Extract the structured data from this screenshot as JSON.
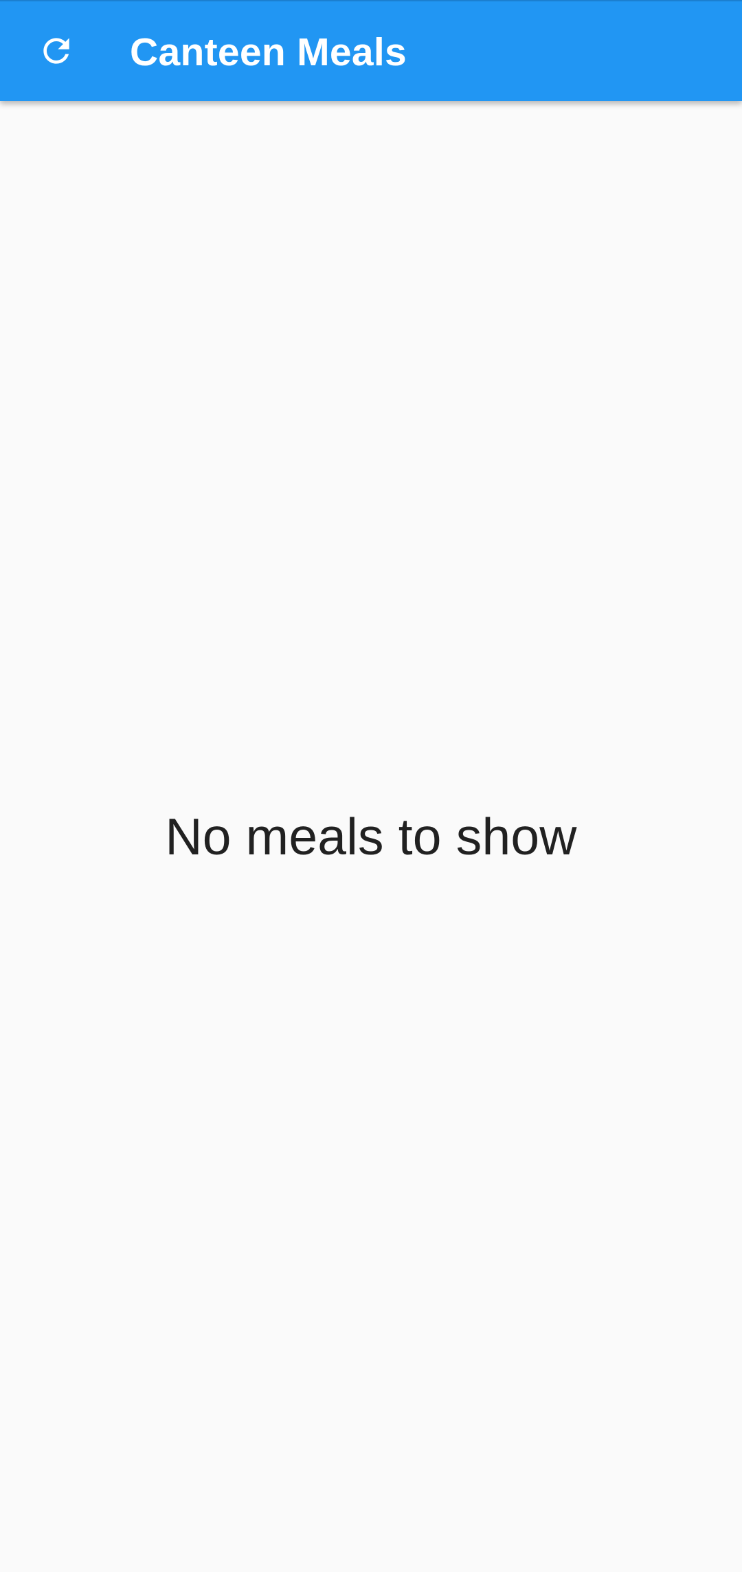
{
  "appbar": {
    "title": "Canteen Meals",
    "background_color": "#2196f3",
    "refresh_icon": "refresh-icon"
  },
  "content": {
    "empty_message": "No meals to show",
    "background_color": "#fafafa",
    "text_color": "#212121"
  }
}
